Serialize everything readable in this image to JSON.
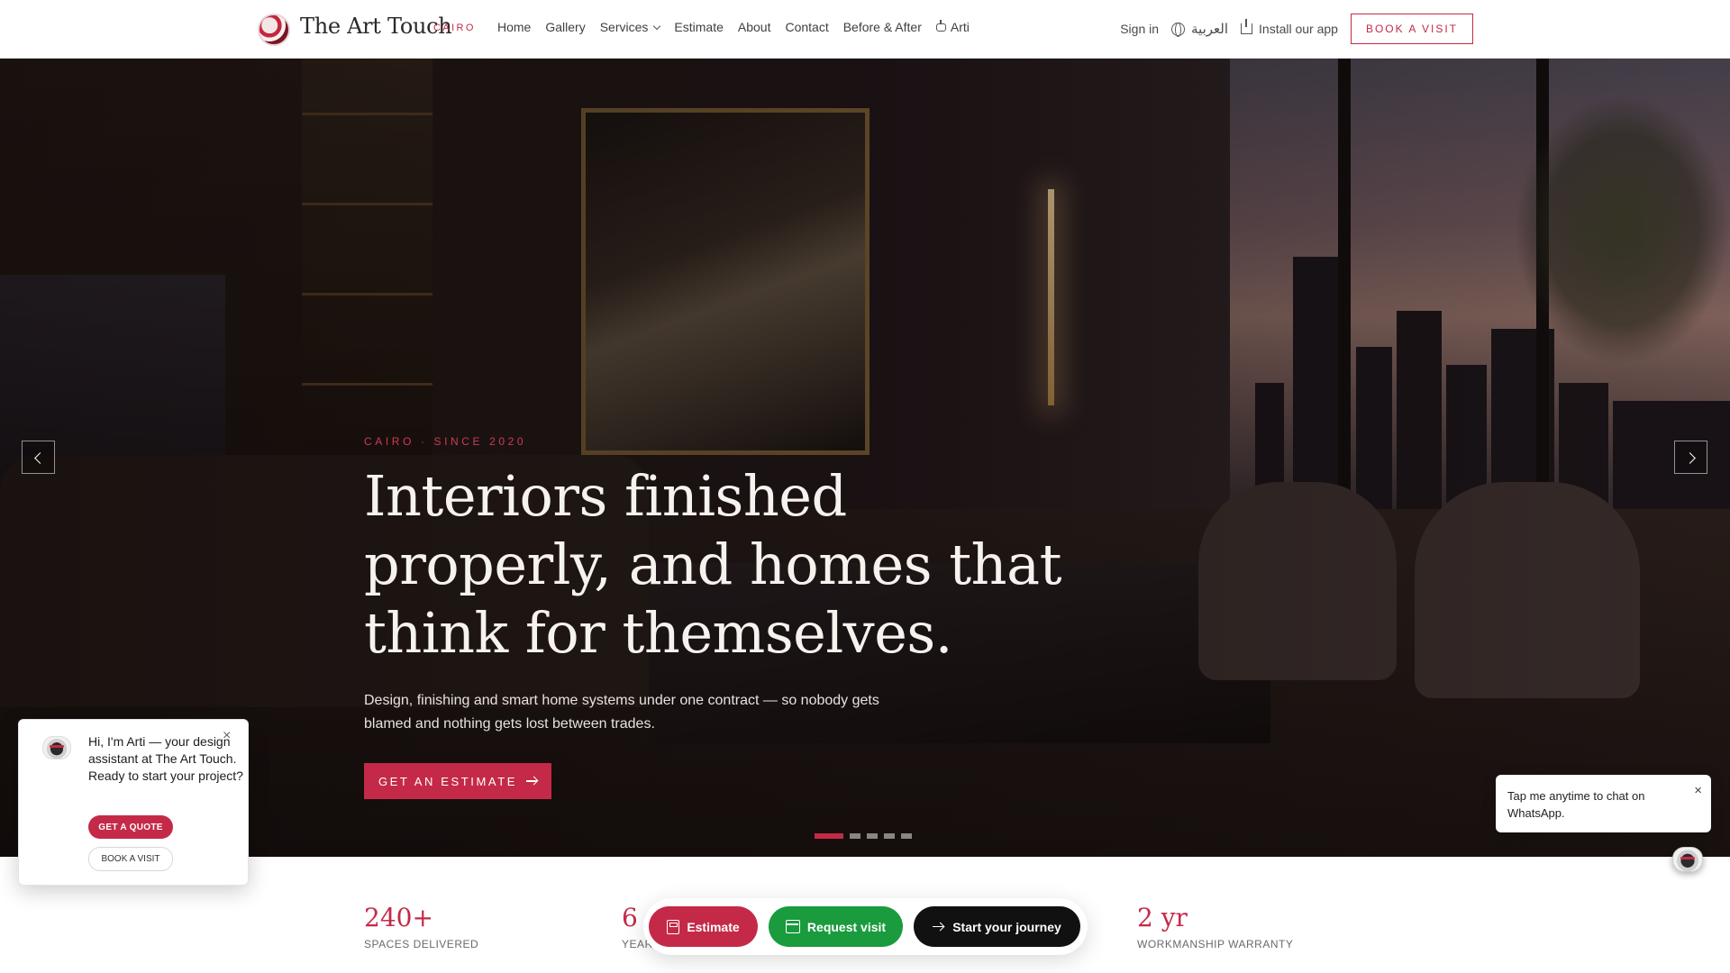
{
  "brand": {
    "name": "The Art Touch",
    "city": "CAIRO"
  },
  "nav": {
    "links": [
      {
        "label": "Home"
      },
      {
        "label": "Gallery"
      },
      {
        "label": "Services",
        "has_dropdown": true
      },
      {
        "label": "Estimate"
      },
      {
        "label": "About"
      },
      {
        "label": "Contact"
      },
      {
        "label": "Before & After"
      },
      {
        "label": "Arti",
        "icon": "robot-icon"
      }
    ],
    "sign_in": "Sign in",
    "language": "العربية",
    "install": "Install our app",
    "book_visit": "BOOK A VISIT"
  },
  "hero": {
    "kicker": "CAIRO · SINCE 2020",
    "title": "Interiors finished properly, and homes that think for themselves.",
    "subtitle": "Design, finishing and smart home systems under one contract — so nobody gets blamed and nothing gets lost between trades.",
    "cta": "GET AN ESTIMATE",
    "slides_total": 5,
    "active_slide": 1
  },
  "stats": [
    {
      "value": "240+",
      "label": "SPACES DELIVERED"
    },
    {
      "value": "6",
      "label": "YEARS"
    },
    {
      "value": "2 yr",
      "label": "WORKMANSHIP WARRANTY"
    }
  ],
  "action_bar": {
    "estimate": "Estimate",
    "request_visit": "Request visit",
    "start_journey": "Start your journey"
  },
  "arti_widget": {
    "message": "Hi, I'm Arti — your design assistant at The Art Touch. Ready to start your project?",
    "quote_button": "GET A QUOTE",
    "visit_button": "BOOK A VISIT",
    "close": "×"
  },
  "whatsapp": {
    "tip": "Tap me anytime to chat on WhatsApp.",
    "close": "×"
  },
  "colors": {
    "accent": "#c42a47",
    "whatsapp_green": "#1a9b3e",
    "dark_button": "#111111"
  }
}
